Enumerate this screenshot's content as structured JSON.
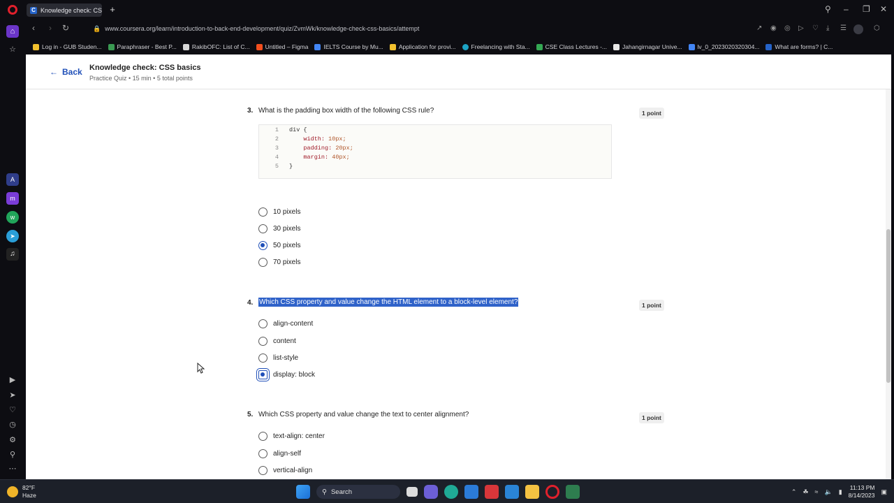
{
  "browser": {
    "tab_title": "Knowledge check: CSS ba",
    "tab_favicon": "C",
    "new_tab": "+",
    "url": "www.coursera.org/learn/introduction-to-back-end-development/quiz/ZvmWk/knowledge-check-css-basics/attempt",
    "bookmarks": [
      {
        "label": "Log in - GUB Studen...",
        "color": "#f2c12e"
      },
      {
        "label": "Paraphraser - Best P...",
        "color": "#3a9a52"
      },
      {
        "label": "RakibOFC: List of C...",
        "color": "#d8d8d8"
      },
      {
        "label": "Untitled – Figma",
        "color": "#f24e1e"
      },
      {
        "label": "IELTS Course by Mu...",
        "color": "#4285f4"
      },
      {
        "label": "Application for provi...",
        "color": "#f2c12e"
      },
      {
        "label": "Freelancing with Sta...",
        "color": "#1ca3c4"
      },
      {
        "label": "CSE Class Lectures -...",
        "color": "#34a853"
      },
      {
        "label": "Jahangirnagar Unive...",
        "color": "#e8e8e8"
      },
      {
        "label": "lv_0_2023020320304...",
        "color": "#4285f4"
      },
      {
        "label": "What are forms? | C...",
        "color": "#2563c9"
      }
    ]
  },
  "header": {
    "back_label": "Back",
    "title": "Knowledge check: CSS basics",
    "subtitle": "Practice Quiz • 15 min • 5 total points"
  },
  "questions": [
    {
      "number": "3.",
      "text": "What is the padding box width of the following CSS rule?",
      "points": "1 point",
      "code": [
        {
          "n": "1",
          "pre": "div {",
          "prop": "",
          "val": ""
        },
        {
          "n": "2",
          "pre": "    ",
          "prop": "width:",
          "val": " 10px;"
        },
        {
          "n": "3",
          "pre": "    ",
          "prop": "padding:",
          "val": " 20px;"
        },
        {
          "n": "4",
          "pre": "    ",
          "prop": "margin:",
          "val": " 40px;"
        },
        {
          "n": "5",
          "pre": "}",
          "prop": "",
          "val": ""
        }
      ],
      "options": [
        "10 pixels",
        "30 pixels",
        "50 pixels",
        "70 pixels"
      ],
      "selected_index": 2
    },
    {
      "number": "4.",
      "text": "Which CSS property and value change the HTML element to a block-level element?",
      "points": "1 point",
      "options": [
        "align-content",
        "content",
        "list-style",
        "display: block"
      ],
      "selected_index": 3
    },
    {
      "number": "5.",
      "text": "Which CSS property and value change the text to center alignment?",
      "points": "1 point",
      "options": [
        "text-align: center",
        "align-self",
        "vertical-align"
      ],
      "selected_index": -1
    }
  ],
  "taskbar": {
    "weather_temp": "82°F",
    "weather_desc": "Haze",
    "search_label": "Search",
    "time": "11:13 PM",
    "date": "8/14/2023"
  }
}
